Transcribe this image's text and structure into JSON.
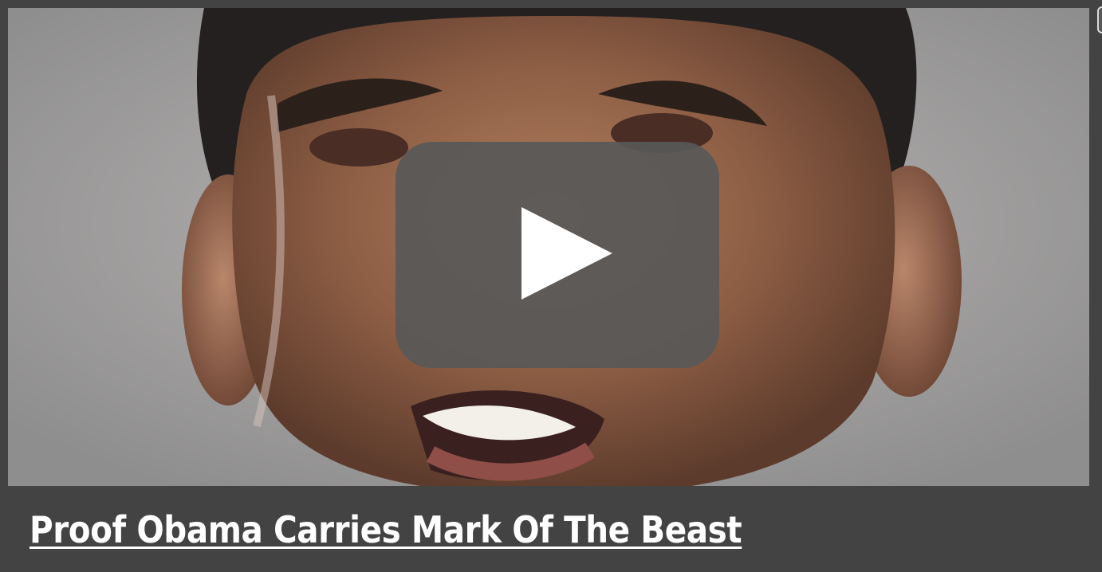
{
  "video": {
    "thumbnail_subject": "close-up portrait of a smiling man",
    "title": "Proof Obama Carries Mark Of The Beast"
  },
  "colors": {
    "frame_background": "#434343",
    "play_button_background": "#585858",
    "play_icon": "#ffffff",
    "title_text": "#ffffff"
  },
  "icons": {
    "play": "play-icon"
  }
}
